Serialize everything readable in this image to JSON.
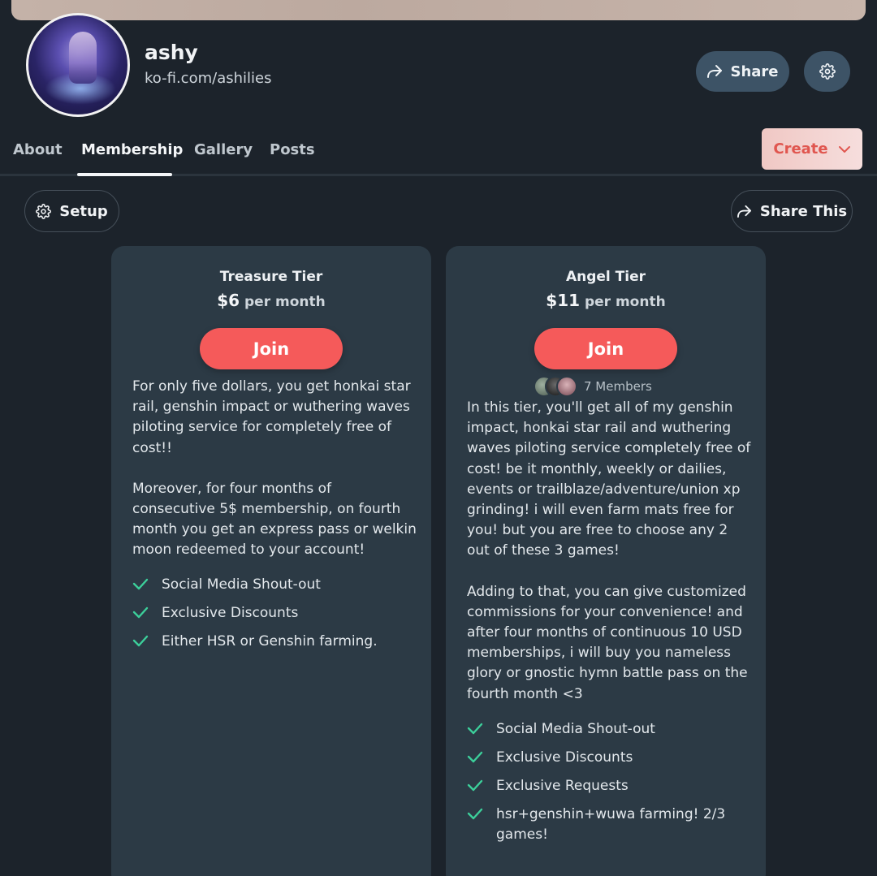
{
  "profile": {
    "name": "ashy",
    "url": "ko-fi.com/ashilies",
    "avatar_icon": "profile-avatar"
  },
  "header": {
    "share_label": "Share",
    "settings_icon": "gear-icon"
  },
  "tabs": [
    {
      "label": "About"
    },
    {
      "label": "Membership",
      "active": true
    },
    {
      "label": "Gallery"
    },
    {
      "label": "Posts"
    }
  ],
  "create_label": "Create",
  "toolbar": {
    "setup_label": "Setup",
    "share_this_label": "Share This"
  },
  "colors": {
    "accent": "#f55a5a",
    "background": "#1c232b",
    "card": "#2c3a45",
    "check": "#3ccf9a"
  },
  "tiers": [
    {
      "name": "Treasure Tier",
      "price": "$6",
      "period": " per month",
      "join_label": "Join",
      "description": [
        "For only five dollars, you get honkai star rail, genshin impact or wuthering waves piloting service for completely free of cost!!",
        "Moreover, for four months of consecutive 5$ membership, on fourth month you get an express pass or welkin moon redeemed to your account!"
      ],
      "perks": [
        "Social Media Shout-out",
        "Exclusive Discounts",
        "Either HSR or Genshin farming."
      ]
    },
    {
      "name": "Angel Tier",
      "price": "$11",
      "period": " per month",
      "join_label": "Join",
      "members_label": "7 Members",
      "description": [
        "In this tier, you'll get all of my genshin impact, honkai star rail and wuthering waves piloting service completely free of cost! be it monthly, weekly or dailies, events or trailblaze/adventure/union xp grinding! i will even farm mats free for you! but you are free to choose any 2 out of these 3 games!",
        "Adding to that, you can give customized commissions for your convenience! and after four months of continuous 10 USD memberships, i will buy you nameless glory or gnostic hymn battle pass on the fourth month <3"
      ],
      "perks": [
        "Social Media Shout-out",
        "Exclusive Discounts",
        "Exclusive Requests",
        "hsr+genshin+wuwa farming! 2/3 games!"
      ]
    }
  ]
}
